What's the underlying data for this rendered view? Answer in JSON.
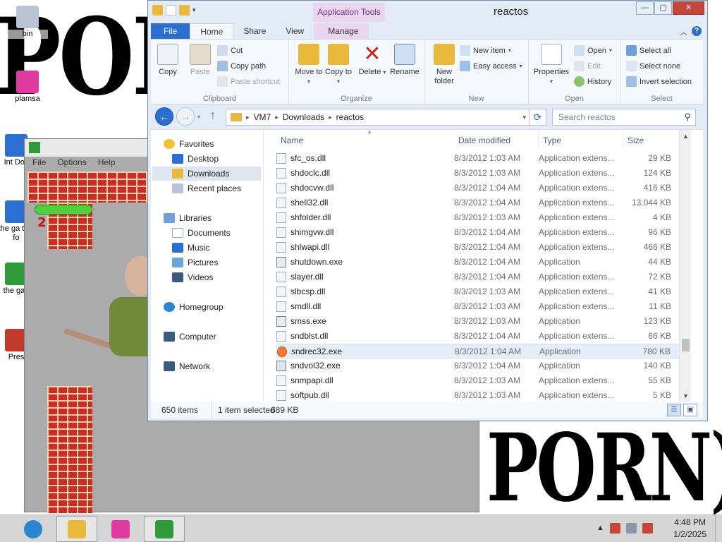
{
  "desktop": {
    "wallpaper_text_top": "PORN)RN",
    "wallpaper_text_bottom": "PORN)PORN",
    "icons": [
      {
        "label": "bin",
        "icon": "recycle-bin-icon",
        "color": "#b8c4d3"
      },
      {
        "label": "plamsa",
        "icon": "plasma-cube-icon",
        "color": "#e0399f"
      },
      {
        "label": "Int Dov",
        "icon": "document-shortcut-icon",
        "color": "#2a6fd1"
      },
      {
        "label": "the ga this fo",
        "icon": "folder-shortcut-icon",
        "color": "#2a6fd1"
      },
      {
        "label": "the gan",
        "icon": "game-shortcut-icon",
        "color": "#2e9a3a"
      },
      {
        "label": "Pres",
        "icon": "presentation-shortcut-icon",
        "color": "#c0392b"
      }
    ]
  },
  "game_window": {
    "menu": [
      "File",
      "Options",
      "Help"
    ],
    "score": "2",
    "colors": {
      "brick": "#d62626",
      "mortar": "#f4d9a9",
      "hero": "#4fd13c",
      "background": "#ababab"
    }
  },
  "explorer": {
    "title": "reactos",
    "context_tab": "Application Tools",
    "caption_buttons": {
      "minimize": "—",
      "maximize": "▢",
      "close": "✕"
    },
    "tabs": {
      "file": "File",
      "home": "Home",
      "share": "Share",
      "view": "View",
      "manage": "Manage"
    },
    "ribbon": {
      "clipboard": {
        "label": "Clipboard",
        "copy": "Copy",
        "paste": "Paste",
        "cut": "Cut",
        "copy_path": "Copy path",
        "paste_shortcut": "Paste shortcut"
      },
      "organize": {
        "label": "Organize",
        "move_to": "Move to",
        "copy_to": "Copy to",
        "delete": "Delete",
        "rename": "Rename"
      },
      "new": {
        "label": "New",
        "new_folder": "New folder",
        "new_item": "New item",
        "easy_access": "Easy access"
      },
      "open": {
        "label": "Open",
        "properties": "Properties",
        "open": "Open",
        "edit": "Edit",
        "history": "History"
      },
      "select": {
        "label": "Select",
        "select_all": "Select all",
        "select_none": "Select none",
        "invert_selection": "Invert selection"
      }
    },
    "address": {
      "segments": [
        "VM7",
        "Downloads",
        "reactos"
      ],
      "search_placeholder": "Search reactos"
    },
    "nav": {
      "favorites": "Favorites",
      "desktop": "Desktop",
      "downloads": "Downloads",
      "recent": "Recent places",
      "libraries": "Libraries",
      "documents": "Documents",
      "music": "Music",
      "pictures": "Pictures",
      "videos": "Videos",
      "homegroup": "Homegroup",
      "computer": "Computer",
      "network": "Network"
    },
    "columns": {
      "name": "Name",
      "date": "Date modified",
      "type": "Type",
      "size": "Size"
    },
    "files": [
      {
        "name": "sfc_os.dll",
        "date": "8/3/2012 1:03 AM",
        "type": "Application extens...",
        "size": "29 KB",
        "icon": "dll"
      },
      {
        "name": "shdoclc.dll",
        "date": "8/3/2012 1:03 AM",
        "type": "Application extens...",
        "size": "124 KB",
        "icon": "dll"
      },
      {
        "name": "shdocvw.dll",
        "date": "8/3/2012 1:04 AM",
        "type": "Application extens...",
        "size": "416 KB",
        "icon": "dll"
      },
      {
        "name": "shell32.dll",
        "date": "8/3/2012 1:04 AM",
        "type": "Application extens...",
        "size": "13,044 KB",
        "icon": "dll"
      },
      {
        "name": "shfolder.dll",
        "date": "8/3/2012 1:03 AM",
        "type": "Application extens...",
        "size": "4 KB",
        "icon": "dll"
      },
      {
        "name": "shimgvw.dll",
        "date": "8/3/2012 1:04 AM",
        "type": "Application extens...",
        "size": "96 KB",
        "icon": "dll"
      },
      {
        "name": "shlwapi.dll",
        "date": "8/3/2012 1:04 AM",
        "type": "Application extens...",
        "size": "466 KB",
        "icon": "dll"
      },
      {
        "name": "shutdown.exe",
        "date": "8/3/2012 1:04 AM",
        "type": "Application",
        "size": "44 KB",
        "icon": "exe"
      },
      {
        "name": "slayer.dll",
        "date": "8/3/2012 1:04 AM",
        "type": "Application extens...",
        "size": "72 KB",
        "icon": "dll"
      },
      {
        "name": "slbcsp.dll",
        "date": "8/3/2012 1:03 AM",
        "type": "Application extens...",
        "size": "41 KB",
        "icon": "dll"
      },
      {
        "name": "smdll.dll",
        "date": "8/3/2012 1:03 AM",
        "type": "Application extens...",
        "size": "11 KB",
        "icon": "dll"
      },
      {
        "name": "smss.exe",
        "date": "8/3/2012 1:03 AM",
        "type": "Application",
        "size": "123 KB",
        "icon": "exe"
      },
      {
        "name": "sndblst.dll",
        "date": "8/3/2012 1:04 AM",
        "type": "Application extens...",
        "size": "66 KB",
        "icon": "dll"
      },
      {
        "name": "sndrec32.exe",
        "date": "8/3/2012 1:04 AM",
        "type": "Application",
        "size": "780 KB",
        "icon": "rec",
        "selected": true
      },
      {
        "name": "sndvol32.exe",
        "date": "8/3/2012 1:04 AM",
        "type": "Application",
        "size": "140 KB",
        "icon": "vol"
      },
      {
        "name": "snmpapi.dll",
        "date": "8/3/2012 1:03 AM",
        "type": "Application extens...",
        "size": "55 KB",
        "icon": "dll"
      },
      {
        "name": "softpub.dll",
        "date": "8/3/2012 1:03 AM",
        "type": "Application extens...",
        "size": "5 KB",
        "icon": "dll"
      }
    ],
    "status": {
      "count": "650 items",
      "selected": "1 item selected",
      "size": "689 KB"
    }
  },
  "taskbar": {
    "clock_time": "4:48 PM",
    "clock_date": "1/2/2025",
    "pinned": [
      {
        "name": "internet-explorer-icon",
        "color": "#2a86d1"
      },
      {
        "name": "file-explorer-icon",
        "color": "#e8b93a"
      },
      {
        "name": "plasma-cube-icon",
        "color": "#e0399f"
      },
      {
        "name": "game-icon",
        "color": "#2e9a3a"
      }
    ]
  }
}
